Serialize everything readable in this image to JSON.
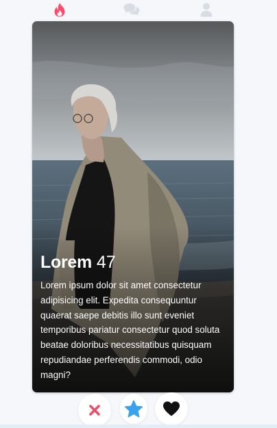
{
  "nav": {
    "items": [
      {
        "icon": "flame-icon",
        "active": true
      },
      {
        "icon": "chat-icon",
        "active": false
      },
      {
        "icon": "user-icon",
        "active": false
      }
    ],
    "active_color": "#ff4a6a",
    "inactive_color": "#d8dde3"
  },
  "card": {
    "name": "Lorem",
    "age": "47",
    "bio": "Lorem ipsum dolor sit amet consectetur adipisicing elit. Expedita consequuntur quaerat saepe debitis illo sunt eveniet temporibus pariatur consectetur quod soluta beatae doloribus necessitatibus quisquam repudiandae perferendis commodi, odio magni?",
    "photo": "man-in-coat-on-beach-photo"
  },
  "actions": [
    {
      "icon": "close-icon",
      "color": "#ec4d6a"
    },
    {
      "icon": "star-icon",
      "color": "#3aa1ec"
    },
    {
      "icon": "heart-icon",
      "color": "#111111"
    }
  ]
}
